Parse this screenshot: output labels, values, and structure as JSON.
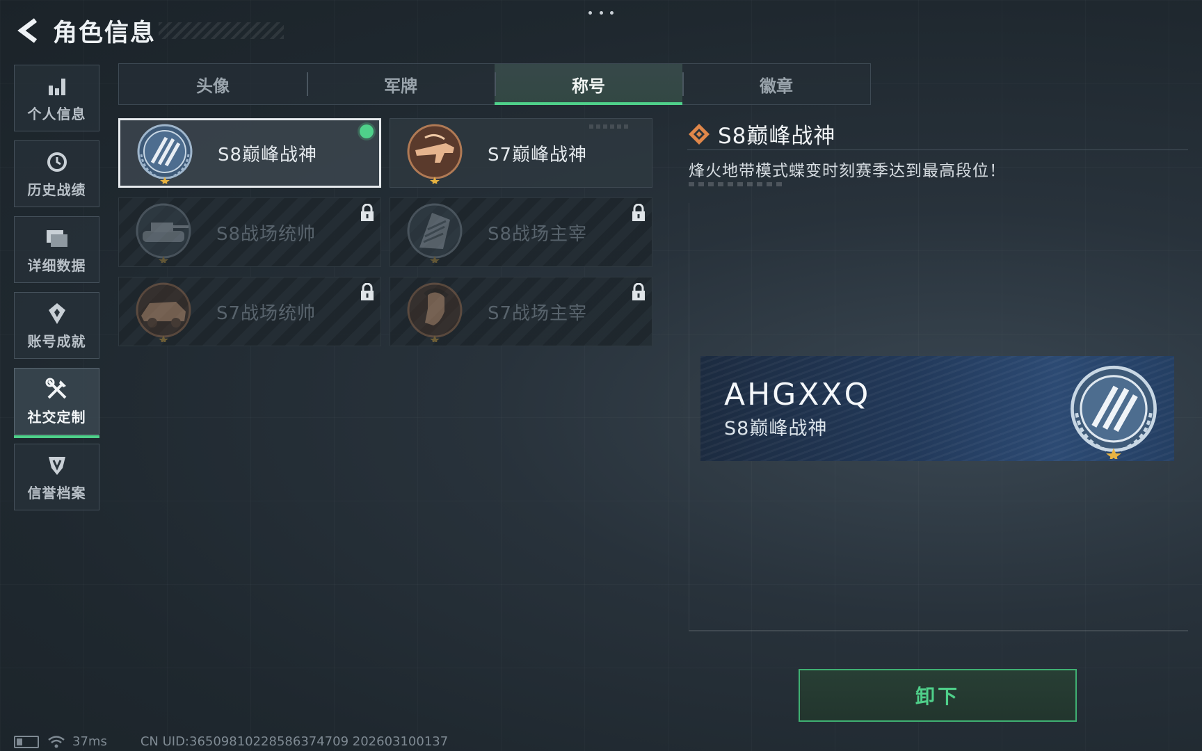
{
  "header": {
    "title": "角色信息"
  },
  "sidebar": {
    "items": [
      {
        "label": "个人信息",
        "icon": "bar-chart-icon",
        "active": false
      },
      {
        "label": "历史战绩",
        "icon": "history-icon",
        "active": false
      },
      {
        "label": "详细数据",
        "icon": "folder-icon",
        "active": false
      },
      {
        "label": "账号成就",
        "icon": "medal-icon",
        "active": false
      },
      {
        "label": "社交定制",
        "icon": "tools-icon",
        "active": true
      },
      {
        "label": "信誉档案",
        "icon": "shield-icon",
        "active": false
      }
    ]
  },
  "tabs": [
    {
      "label": "头像",
      "active": false
    },
    {
      "label": "军牌",
      "active": false
    },
    {
      "label": "称号",
      "active": true
    },
    {
      "label": "徽章",
      "active": false
    }
  ],
  "titles": [
    {
      "name": "S8巅峰战神",
      "state": "equipped",
      "medal": "blue-laurel"
    },
    {
      "name": "S7巅峰战神",
      "state": "unlocked",
      "medal": "bronze-weapon"
    },
    {
      "name": "S8战场统帅",
      "state": "locked",
      "medal": "tank"
    },
    {
      "name": "S8战场主宰",
      "state": "locked",
      "medal": "building"
    },
    {
      "name": "S7战场统帅",
      "state": "locked",
      "medal": "vehicle"
    },
    {
      "name": "S7战场主宰",
      "state": "locked",
      "medal": "soldier"
    }
  ],
  "detail": {
    "title": "S8巅峰战神",
    "description": "烽火地带模式蝶变时刻赛季达到最高段位！"
  },
  "banner": {
    "player_name": "AHGXXQ",
    "title": "S8巅峰战神"
  },
  "actions": {
    "unequip_label": "卸下"
  },
  "status": {
    "ping": "37ms",
    "uid_line": "CN UID:3650981022858637470​9 202603100137"
  },
  "colors": {
    "accent_green": "#4fd08a",
    "detail_icon_orange": "#e0874a",
    "banner_blue": "#22395a"
  }
}
